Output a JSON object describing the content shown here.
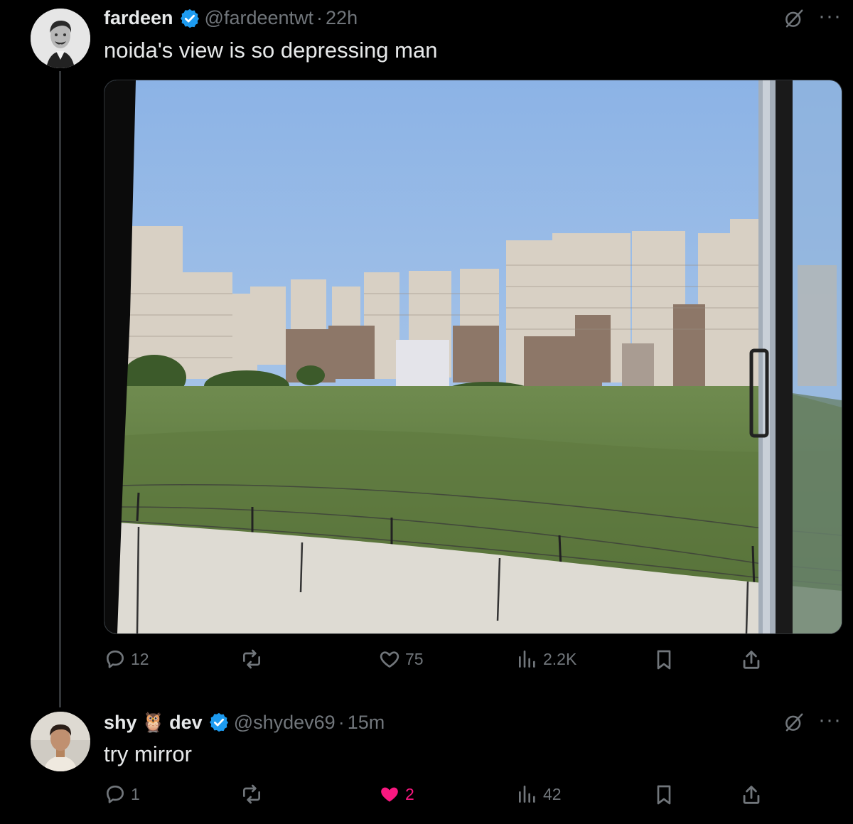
{
  "thread_line_color": "#333639",
  "tweet1": {
    "name": "fardeen",
    "handle": "@fardeentwt",
    "separator": "·",
    "time": "22h",
    "text": "noida's view is so depressing man",
    "more": "···",
    "actions": {
      "replies": "12",
      "reposts": "",
      "likes": "75",
      "views": "2.2K"
    }
  },
  "tweet2": {
    "name_part1": "shy",
    "name_emoji": "🦉",
    "name_part2": "dev",
    "handle": "@shydev69",
    "separator": "·",
    "time": "15m",
    "text": "try mirror",
    "more": "···",
    "actions": {
      "replies": "1",
      "reposts": "",
      "likes": "2",
      "views": "42"
    }
  },
  "colors": {
    "verified": "#1d9bf0",
    "muted": "#71767b",
    "like_active": "#f91880",
    "text": "#e7e9ea"
  },
  "icons": [
    "verified-badge-icon",
    "grok-icon",
    "more-icon",
    "reply-icon",
    "repost-icon",
    "like-icon",
    "views-icon",
    "bookmark-icon",
    "share-icon"
  ]
}
